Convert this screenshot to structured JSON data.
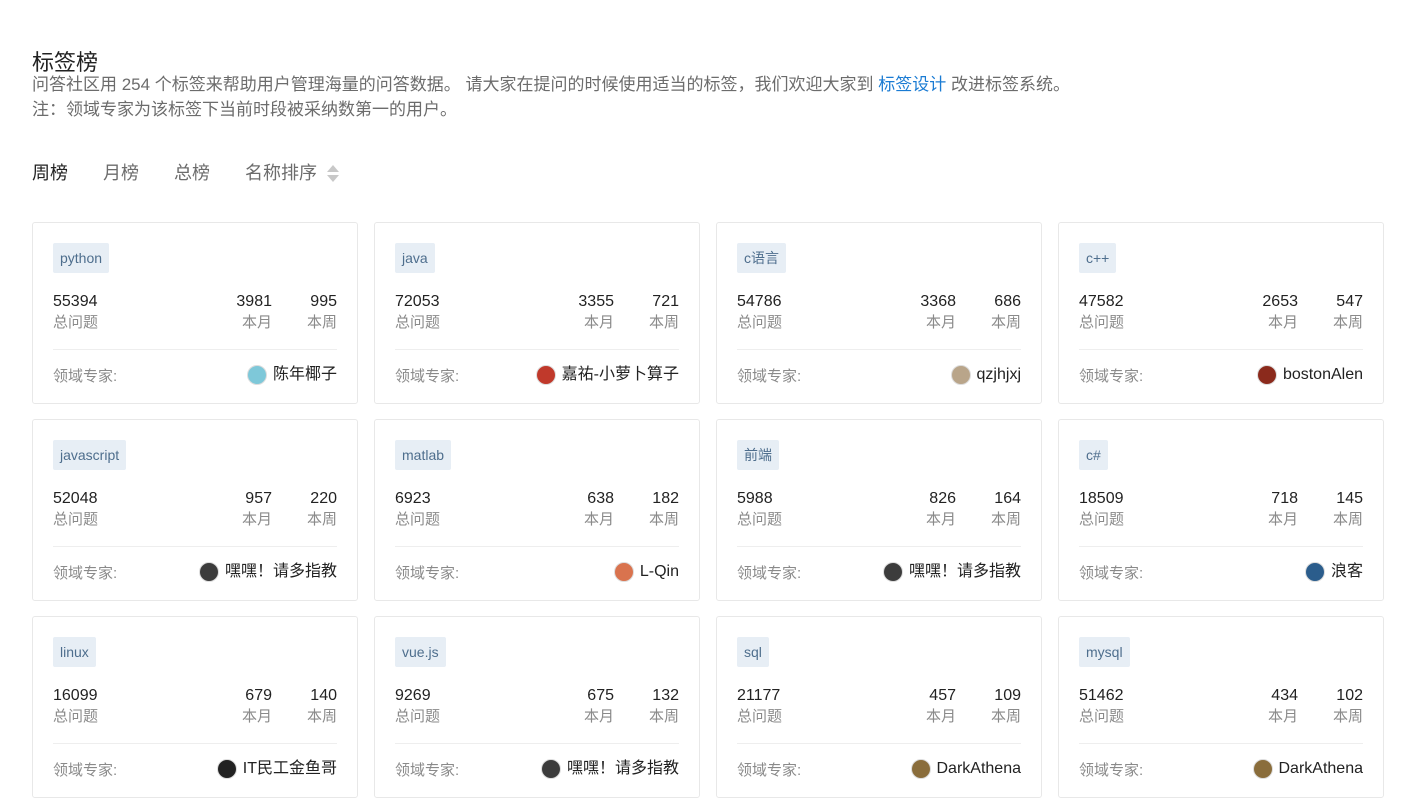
{
  "page": {
    "title": "标签榜",
    "intro_line1_before": "问答社区用 254 个标签来帮助用户管理海量的问答数据。 请大家在提问的时候使用适当的标签，我们欢迎大家到 ",
    "intro_link": "标签设计",
    "intro_line1_after": " 改进标签系统。",
    "intro_line2": "注：领域专家为该标签下当前时段被采纳数第一的用户。"
  },
  "tabs": [
    {
      "label": "周榜",
      "active": true
    },
    {
      "label": "月榜",
      "active": false
    },
    {
      "label": "总榜",
      "active": false
    },
    {
      "label": "名称排序",
      "active": false,
      "sort_icon": "sort-arrows-icon"
    }
  ],
  "labels": {
    "total": "总问题",
    "month": "本月",
    "week": "本周",
    "expert": "领域专家:"
  },
  "cards": [
    {
      "tag": "python",
      "total": "55394",
      "month": "3981",
      "week": "995",
      "expert": "陈年椰子",
      "avatar_color": "#7ec8d9"
    },
    {
      "tag": "java",
      "total": "72053",
      "month": "3355",
      "week": "721",
      "expert": "嘉祐-小萝卜算子",
      "avatar_color": "#c0392b"
    },
    {
      "tag": "c语言",
      "total": "54786",
      "month": "3368",
      "week": "686",
      "expert": "qzjhjxj",
      "avatar_color": "#b9a58a"
    },
    {
      "tag": "c++",
      "total": "47582",
      "month": "2653",
      "week": "547",
      "expert": "bostonAlen",
      "avatar_color": "#8b2a1c"
    },
    {
      "tag": "javascript",
      "total": "52048",
      "month": "957",
      "week": "220",
      "expert": "嘿嘿！请多指教",
      "avatar_color": "#3c3c3c"
    },
    {
      "tag": "matlab",
      "total": "6923",
      "month": "638",
      "week": "182",
      "expert": "L-Qin",
      "avatar_color": "#d9734e"
    },
    {
      "tag": "前端",
      "total": "5988",
      "month": "826",
      "week": "164",
      "expert": "嘿嘿！请多指教",
      "avatar_color": "#3c3c3c"
    },
    {
      "tag": "c#",
      "total": "18509",
      "month": "718",
      "week": "145",
      "expert": "浪客",
      "avatar_color": "#2b5d8c"
    },
    {
      "tag": "linux",
      "total": "16099",
      "month": "679",
      "week": "140",
      "expert": "IT民工金鱼哥",
      "avatar_color": "#222222"
    },
    {
      "tag": "vue.js",
      "total": "9269",
      "month": "675",
      "week": "132",
      "expert": "嘿嘿！请多指教",
      "avatar_color": "#3c3c3c"
    },
    {
      "tag": "sql",
      "total": "21177",
      "month": "457",
      "week": "109",
      "expert": "DarkAthena",
      "avatar_color": "#8a6d3b"
    },
    {
      "tag": "mysql",
      "total": "51462",
      "month": "434",
      "week": "102",
      "expert": "DarkAthena",
      "avatar_color": "#8a6d3b"
    }
  ]
}
